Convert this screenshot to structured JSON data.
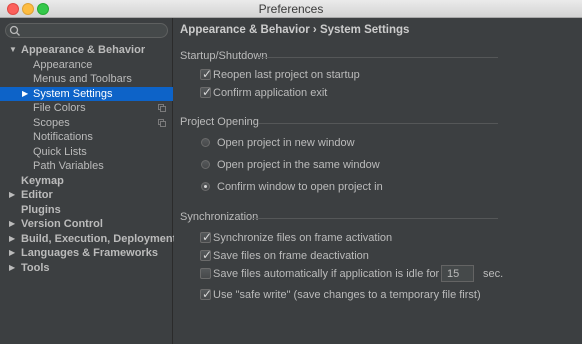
{
  "window": {
    "title": "Preferences"
  },
  "search": {
    "placeholder": ""
  },
  "tree": {
    "appearance_behavior": "Appearance & Behavior",
    "appearance": "Appearance",
    "menus_toolbars": "Menus and Toolbars",
    "system_settings": "System Settings",
    "file_colors": "File Colors",
    "scopes": "Scopes",
    "notifications": "Notifications",
    "quick_lists": "Quick Lists",
    "path_variables": "Path Variables",
    "keymap": "Keymap",
    "editor": "Editor",
    "plugins": "Plugins",
    "version_control": "Version Control",
    "build": "Build, Execution, Deployment",
    "languages": "Languages & Frameworks",
    "tools": "Tools"
  },
  "main": {
    "breadcrumb": "Appearance & Behavior › System Settings",
    "startup": {
      "title": "Startup/Shutdown",
      "reopen": "Reopen last project on startup",
      "reopen_checked": true,
      "confirm_exit": "Confirm application exit",
      "confirm_exit_checked": true
    },
    "project_opening": {
      "title": "Project Opening",
      "new_window": "Open project in new window",
      "same_window": "Open project in the same window",
      "confirm_window": "Confirm window to open project in",
      "selected": "confirm_window"
    },
    "sync": {
      "title": "Synchronization",
      "sync_files": "Synchronize files on frame activation",
      "sync_files_checked": true,
      "save_deactivation": "Save files on frame deactivation",
      "save_deactivation_checked": true,
      "save_idle": "Save files automatically if application is idle for",
      "save_idle_checked": false,
      "idle_value": "15",
      "idle_unit": "sec.",
      "safe_write": "Use \"safe write\" (save changes to a temporary file first)",
      "safe_write_checked": true
    }
  }
}
